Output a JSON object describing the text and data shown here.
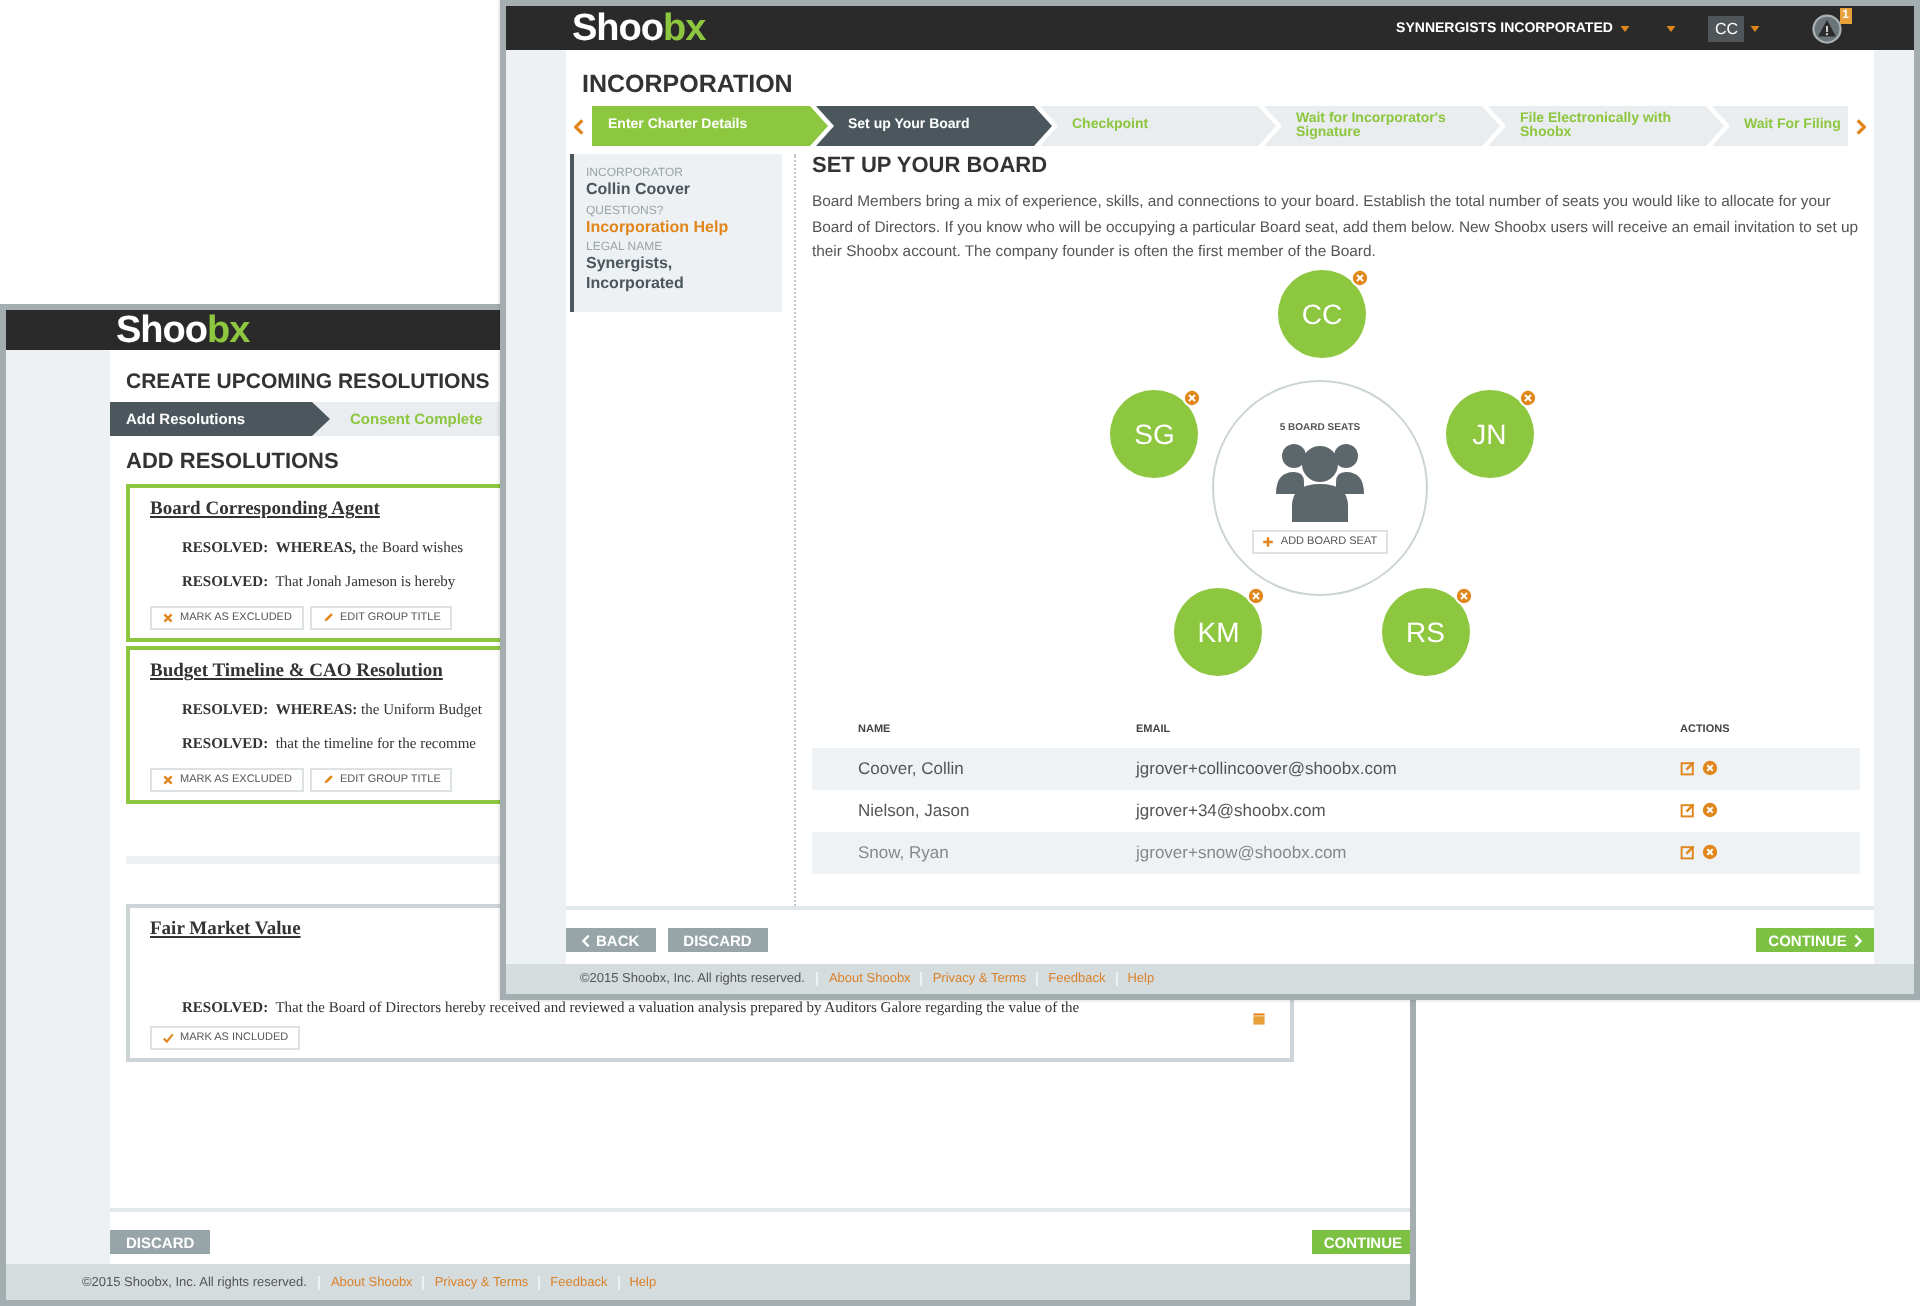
{
  "back_window": {
    "logo": {
      "lead": "Shoo",
      "accent": "bx"
    },
    "title": "CREATE UPCOMING RESOLUTIONS",
    "steps": [
      {
        "label": "Add Resolutions",
        "selected": true
      },
      {
        "label": "Consent Complete",
        "selected": false
      }
    ],
    "section_title": "ADD RESOLUTIONS",
    "groups": [
      {
        "title": "Board Corresponding Agent",
        "included": true,
        "resolutions": [
          "**RESOLVED:**  **WHEREAS,** the Board wishes",
          "**RESOLVED:**  That Jonah Jameson is hereby"
        ],
        "toggle_label": "MARK AS EXCLUDED",
        "edit_label": "EDIT GROUP TITLE"
      },
      {
        "title": "Budget Timeline & CAO Resolution",
        "included": true,
        "resolutions": [
          "**RESOLVED:**  **WHEREAS:** the Uniform Budget",
          "**RESOLVED:**  that the timeline for the recomme"
        ],
        "toggle_label": "MARK AS EXCLUDED",
        "edit_label": "EDIT GROUP TITLE"
      },
      {
        "title": "Fair Market Value",
        "included": false,
        "resolutions": [
          "**RESOLVED:**  That the Board of Directors hereby received and reviewed a valuation analysis prepared by Auditors Galore regarding the value of the"
        ],
        "toggle_label": "MARK AS INCLUDED"
      }
    ],
    "actions": {
      "discard": "DISCARD",
      "continue": "CONTINUE"
    },
    "footer": {
      "copyright": "©2015 Shoobx, Inc. All rights reserved.",
      "links": [
        "About Shoobx",
        "Privacy & Terms",
        "Feedback",
        "Help"
      ]
    }
  },
  "front_window": {
    "logo": {
      "lead": "Shoo",
      "accent": "bx"
    },
    "account": "SYNNERGISTS INCORPORATED",
    "user": "CC",
    "alert_count": "1",
    "title": "INCORPORATION",
    "steps": [
      {
        "label": "Enter Charter Details",
        "selected": false,
        "completed": true
      },
      {
        "label": "Set up Your Board",
        "selected": true,
        "completed": false
      },
      {
        "label": "Checkpoint",
        "selected": false,
        "completed": false
      },
      {
        "label": "Wait for Incorporator's Signature",
        "selected": false,
        "completed": false
      },
      {
        "label": "File Electronically with Shoobx",
        "selected": false,
        "completed": false
      },
      {
        "label": "Wait For Filing",
        "selected": false,
        "completed": false
      }
    ],
    "sidebar": [
      {
        "label": "INCORPORATOR",
        "value": "Collin Coover",
        "kind": "text"
      },
      {
        "label": "QUESTIONS?",
        "value": "Incorporation Help",
        "kind": "link"
      },
      {
        "label": "LEGAL NAME",
        "value": "Synergists, Incorporated",
        "kind": "text"
      }
    ],
    "heading": "SET UP YOUR BOARD",
    "intro": "Board Members bring a mix of experience, skills, and connections to your board. Establish the total number of seats you would like to allocate for your Board of Directors. If you know who will be occupying a particular Board seat, add them below. New Shoobx users will receive an email invitation to set up their Shoobx account. The company founder is often the first member of the Board.",
    "board": {
      "seats_label": "5 BOARD SEATS",
      "add_label": "ADD BOARD SEAT",
      "seats": [
        {
          "initials": "CC"
        },
        {
          "initials": "JN"
        },
        {
          "initials": "RS"
        },
        {
          "initials": "KM"
        },
        {
          "initials": "SG"
        }
      ]
    },
    "table": {
      "columns": [
        "NAME",
        "EMAIL",
        "ACTIONS"
      ],
      "rows": [
        {
          "name": "Coover, Collin",
          "email": "jgrover+collincoover@shoobx.com"
        },
        {
          "name": "Nielson, Jason",
          "email": "jgrover+34@shoobx.com"
        },
        {
          "name": "Snow, Ryan",
          "email": "jgrover+snow@shoobx.com"
        }
      ]
    },
    "actions": {
      "back": "BACK",
      "discard": "DISCARD",
      "continue": "CONTINUE"
    },
    "footer": {
      "copyright": "©2015 Shoobx, Inc. All rights reserved.",
      "links": [
        "About Shoobx",
        "Privacy & Terms",
        "Feedback",
        "Help"
      ]
    }
  }
}
